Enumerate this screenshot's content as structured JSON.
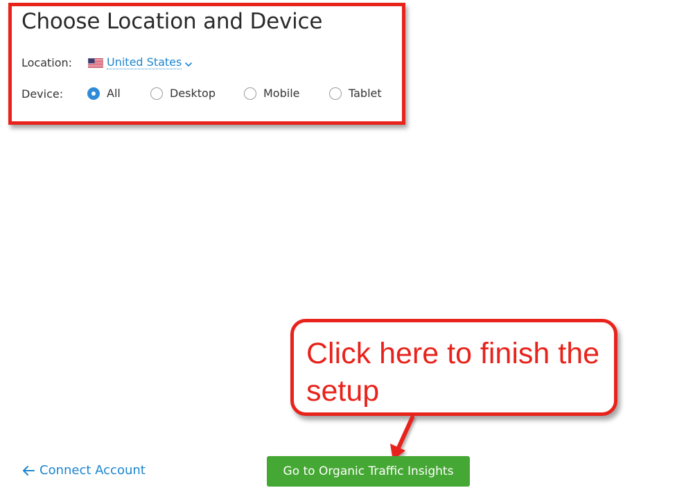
{
  "settings": {
    "title": "Choose Location and Device",
    "location_label": "Location:",
    "location_value": "United States",
    "location_flag_icon": "us-flag-icon",
    "device_label": "Device:",
    "device_options": [
      {
        "label": "All",
        "checked": true
      },
      {
        "label": "Desktop",
        "checked": false
      },
      {
        "label": "Mobile",
        "checked": false
      },
      {
        "label": "Tablet",
        "checked": false
      }
    ]
  },
  "callout": {
    "text": "Click here to finish the setup",
    "color": "#e8231b"
  },
  "footer": {
    "back_label": "Connect Account",
    "back_icon": "arrow-left-icon",
    "primary_label": "Go to Organic Traffic Insights"
  },
  "colors": {
    "accent": "#1b85cf",
    "primary_button": "#46a834",
    "highlight": "#e8231b",
    "radio_checked": "#2e8bd9"
  }
}
